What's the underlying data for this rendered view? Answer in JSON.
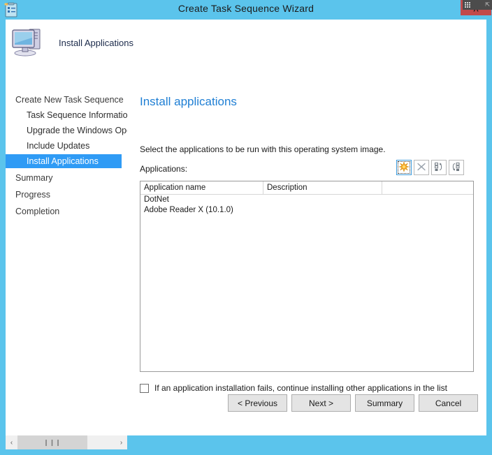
{
  "window": {
    "title": "Create Task Sequence Wizard",
    "title_icon": "task-list-clipboard-icon",
    "close_label": "˄",
    "titlebar_color": "#5bc4ec",
    "accent_color": "#2f9bf5"
  },
  "banner": {
    "icon": "computer-monitor-icon",
    "title": "Install Applications"
  },
  "sidebar": {
    "items": [
      {
        "label": "Create New Task Sequence",
        "level": 0,
        "selected": false
      },
      {
        "label": "Task Sequence Information",
        "level": 1,
        "selected": false
      },
      {
        "label": "Upgrade the Windows Operating System",
        "level": 1,
        "selected": false
      },
      {
        "label": "Include Updates",
        "level": 1,
        "selected": false
      },
      {
        "label": "Install Applications",
        "level": 1,
        "selected": true
      },
      {
        "label": "Summary",
        "level": 0,
        "selected": false
      },
      {
        "label": "Progress",
        "level": 0,
        "selected": false
      },
      {
        "label": "Completion",
        "level": 0,
        "selected": false
      }
    ]
  },
  "main": {
    "heading": "Install applications",
    "intro": "Select the applications to be run with this operating system image.",
    "field_label": "Applications:",
    "toolbar": [
      {
        "name": "add-application-button",
        "icon": "orange-starburst-new-icon",
        "focused": true
      },
      {
        "name": "delete-application-button",
        "icon": "x-delete-icon",
        "focused": false
      },
      {
        "name": "move-up-button",
        "icon": "list-move-up-icon",
        "focused": false
      },
      {
        "name": "move-down-button",
        "icon": "list-move-down-icon",
        "focused": false
      }
    ],
    "list": {
      "columns": [
        "Application name",
        "Description",
        ""
      ],
      "rows": [
        {
          "name": "DotNet",
          "description": "",
          "extra": ""
        },
        {
          "name": "Adobe Reader X (10.1.0)",
          "description": "",
          "extra": ""
        }
      ]
    },
    "checkbox": {
      "label": "If an application installation fails, continue installing other applications in the list",
      "checked": false
    }
  },
  "footer": {
    "buttons": [
      {
        "label": "< Previous",
        "name": "previous-button"
      },
      {
        "label": "Next >",
        "name": "next-button"
      },
      {
        "label": "Summary",
        "name": "summary-button"
      },
      {
        "label": "Cancel",
        "name": "cancel-button"
      }
    ]
  },
  "scrollbar": {
    "left_arrow": "‹",
    "right_arrow": "›",
    "grip": "❙❙❙"
  }
}
